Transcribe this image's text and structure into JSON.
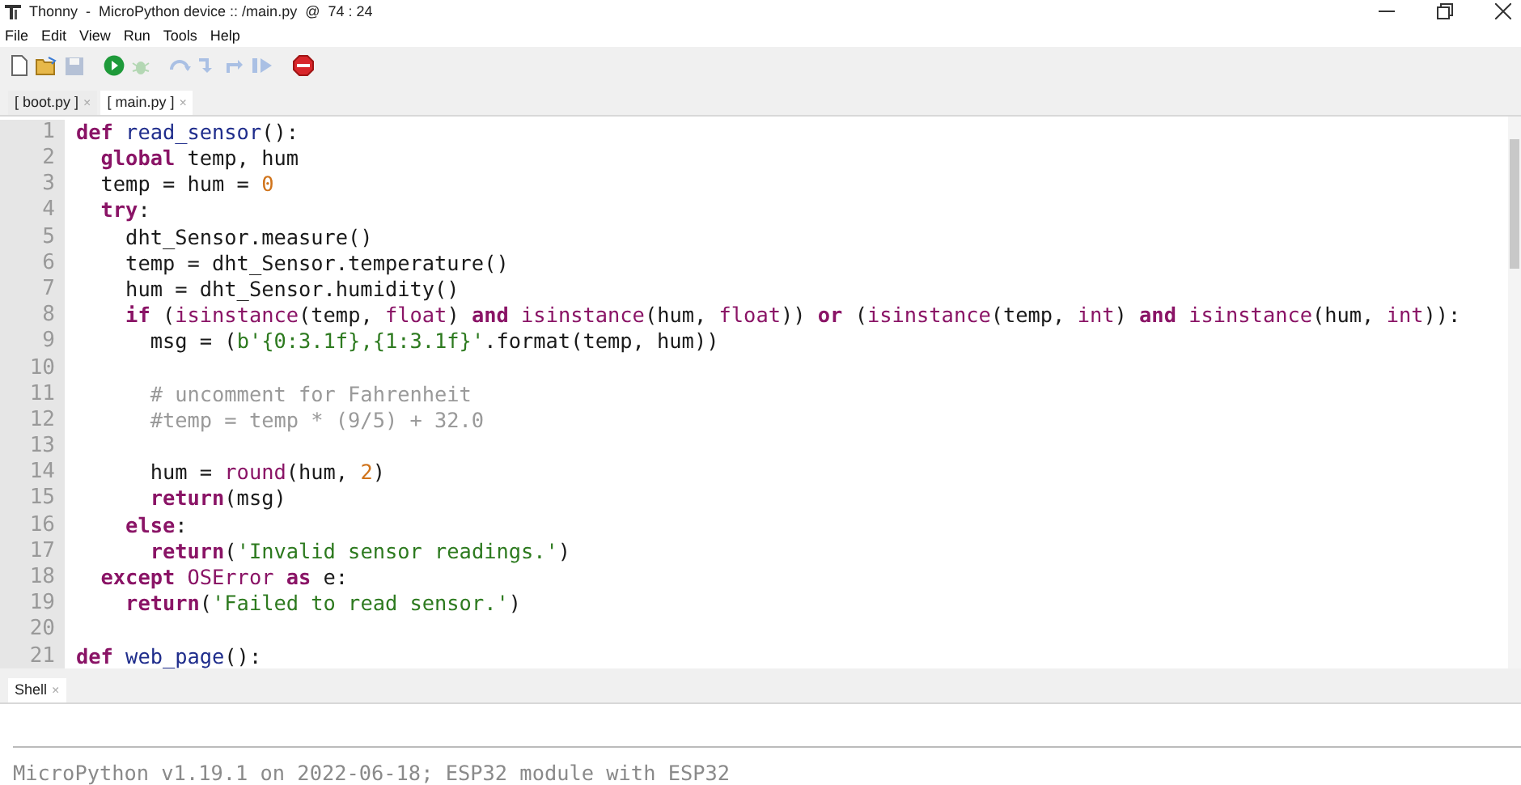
{
  "window": {
    "title": "Thonny  -  MicroPython device :: /main.py  @  74 : 24"
  },
  "menu": [
    "File",
    "Edit",
    "View",
    "Run",
    "Tools",
    "Help"
  ],
  "toolbar": [
    {
      "kind": "new",
      "disabled": false
    },
    {
      "kind": "open",
      "disabled": false
    },
    {
      "kind": "save",
      "disabled": true
    },
    {
      "kind": "run",
      "disabled": false
    },
    {
      "kind": "debug",
      "disabled": true
    },
    {
      "kind": "step-over",
      "disabled": true
    },
    {
      "kind": "step-into",
      "disabled": true
    },
    {
      "kind": "step-out",
      "disabled": true
    },
    {
      "kind": "resume",
      "disabled": true
    },
    {
      "kind": "stop",
      "disabled": false
    }
  ],
  "tabs": [
    {
      "label": "[ boot.py ]",
      "close": "×",
      "selected": false
    },
    {
      "label": "[ main.py ]",
      "close": "×",
      "selected": true
    }
  ],
  "editor": {
    "lines": [
      {
        "number": "1",
        "tokens": [
          {
            "kind": "keyword",
            "text": "def"
          },
          {
            "kind": "defname",
            "text": " read_sensor"
          },
          {
            "kind": "plain",
            "text": "():"
          }
        ]
      },
      {
        "number": "2",
        "tokens": [
          {
            "kind": "keyword",
            "text": "  global"
          },
          {
            "kind": "plain",
            "text": " temp, hum"
          }
        ]
      },
      {
        "number": "3",
        "tokens": [
          {
            "kind": "plain",
            "text": "  temp = hum = "
          },
          {
            "kind": "number",
            "text": "0"
          }
        ]
      },
      {
        "number": "4",
        "tokens": [
          {
            "kind": "keyword",
            "text": "  try"
          },
          {
            "kind": "plain",
            "text": ":"
          }
        ]
      },
      {
        "number": "5",
        "tokens": [
          {
            "kind": "plain",
            "text": "    dht_Sensor.measure()"
          }
        ]
      },
      {
        "number": "6",
        "tokens": [
          {
            "kind": "plain",
            "text": "    temp = dht_Sensor.temperature()"
          }
        ]
      },
      {
        "number": "7",
        "tokens": [
          {
            "kind": "plain",
            "text": "    hum = dht_Sensor.humidity()"
          }
        ]
      },
      {
        "number": "8",
        "tokens": [
          {
            "kind": "keyword",
            "text": "    if"
          },
          {
            "kind": "plain",
            "text": " ("
          },
          {
            "kind": "builtin",
            "text": "isinstance"
          },
          {
            "kind": "plain",
            "text": "(temp, "
          },
          {
            "kind": "builtin",
            "text": "float"
          },
          {
            "kind": "plain",
            "text": ") "
          },
          {
            "kind": "keyword",
            "text": "and"
          },
          {
            "kind": "builtin",
            "text": " isinstance"
          },
          {
            "kind": "plain",
            "text": "(hum, "
          },
          {
            "kind": "builtin",
            "text": "float"
          },
          {
            "kind": "plain",
            "text": ")) "
          },
          {
            "kind": "keyword",
            "text": "or"
          },
          {
            "kind": "plain",
            "text": " ("
          },
          {
            "kind": "builtin",
            "text": "isinstance"
          },
          {
            "kind": "plain",
            "text": "(temp, "
          },
          {
            "kind": "builtin",
            "text": "int"
          },
          {
            "kind": "plain",
            "text": ") "
          },
          {
            "kind": "keyword",
            "text": "and"
          },
          {
            "kind": "builtin",
            "text": " isinstance"
          },
          {
            "kind": "plain",
            "text": "(hum, "
          },
          {
            "kind": "builtin",
            "text": "int"
          },
          {
            "kind": "plain",
            "text": ")):"
          }
        ]
      },
      {
        "number": "9",
        "tokens": [
          {
            "kind": "plain",
            "text": "      msg = ("
          },
          {
            "kind": "string",
            "text": "b'{0:3.1f},{1:3.1f}'"
          },
          {
            "kind": "plain",
            "text": ".format(temp, hum))"
          }
        ]
      },
      {
        "number": "10"
      },
      {
        "number": "11",
        "tokens": [
          {
            "kind": "comment",
            "text": "      # uncomment for Fahrenheit"
          }
        ]
      },
      {
        "number": "12",
        "tokens": [
          {
            "kind": "comment",
            "text": "      #temp = temp * (9/5) + 32.0"
          }
        ]
      },
      {
        "number": "13"
      },
      {
        "number": "14",
        "tokens": [
          {
            "kind": "plain",
            "text": "      hum = "
          },
          {
            "kind": "builtin",
            "text": "round"
          },
          {
            "kind": "plain",
            "text": "(hum, "
          },
          {
            "kind": "number",
            "text": "2"
          },
          {
            "kind": "plain",
            "text": ")"
          }
        ]
      },
      {
        "number": "15",
        "tokens": [
          {
            "kind": "keyword",
            "text": "      return"
          },
          {
            "kind": "plain",
            "text": "(msg)"
          }
        ]
      },
      {
        "number": "16",
        "tokens": [
          {
            "kind": "keyword",
            "text": "    else"
          },
          {
            "kind": "plain",
            "text": ":"
          }
        ]
      },
      {
        "number": "17",
        "tokens": [
          {
            "kind": "keyword",
            "text": "      return"
          },
          {
            "kind": "plain",
            "text": "("
          },
          {
            "kind": "string",
            "text": "'Invalid sensor readings.'"
          },
          {
            "kind": "plain",
            "text": ")"
          }
        ]
      },
      {
        "number": "18",
        "tokens": [
          {
            "kind": "keyword",
            "text": "  except"
          },
          {
            "kind": "builtin",
            "text": " OSError"
          },
          {
            "kind": "keyword",
            "text": " as"
          },
          {
            "kind": "plain",
            "text": " e:"
          }
        ]
      },
      {
        "number": "19",
        "tokens": [
          {
            "kind": "keyword",
            "text": "    return"
          },
          {
            "kind": "plain",
            "text": "("
          },
          {
            "kind": "string",
            "text": "'Failed to read sensor.'"
          },
          {
            "kind": "plain",
            "text": ")"
          }
        ]
      },
      {
        "number": "20"
      },
      {
        "number": "21",
        "tokens": [
          {
            "kind": "keyword",
            "text": "def"
          },
          {
            "kind": "defname",
            "text": " web_page"
          },
          {
            "kind": "plain",
            "text": "():"
          }
        ]
      }
    ]
  },
  "shell": {
    "tab": {
      "label": "Shell",
      "close": "×",
      "selected": true
    },
    "output": "MicroPython v1.19.1 on 2022-06-18; ESP32 module with ESP32"
  }
}
